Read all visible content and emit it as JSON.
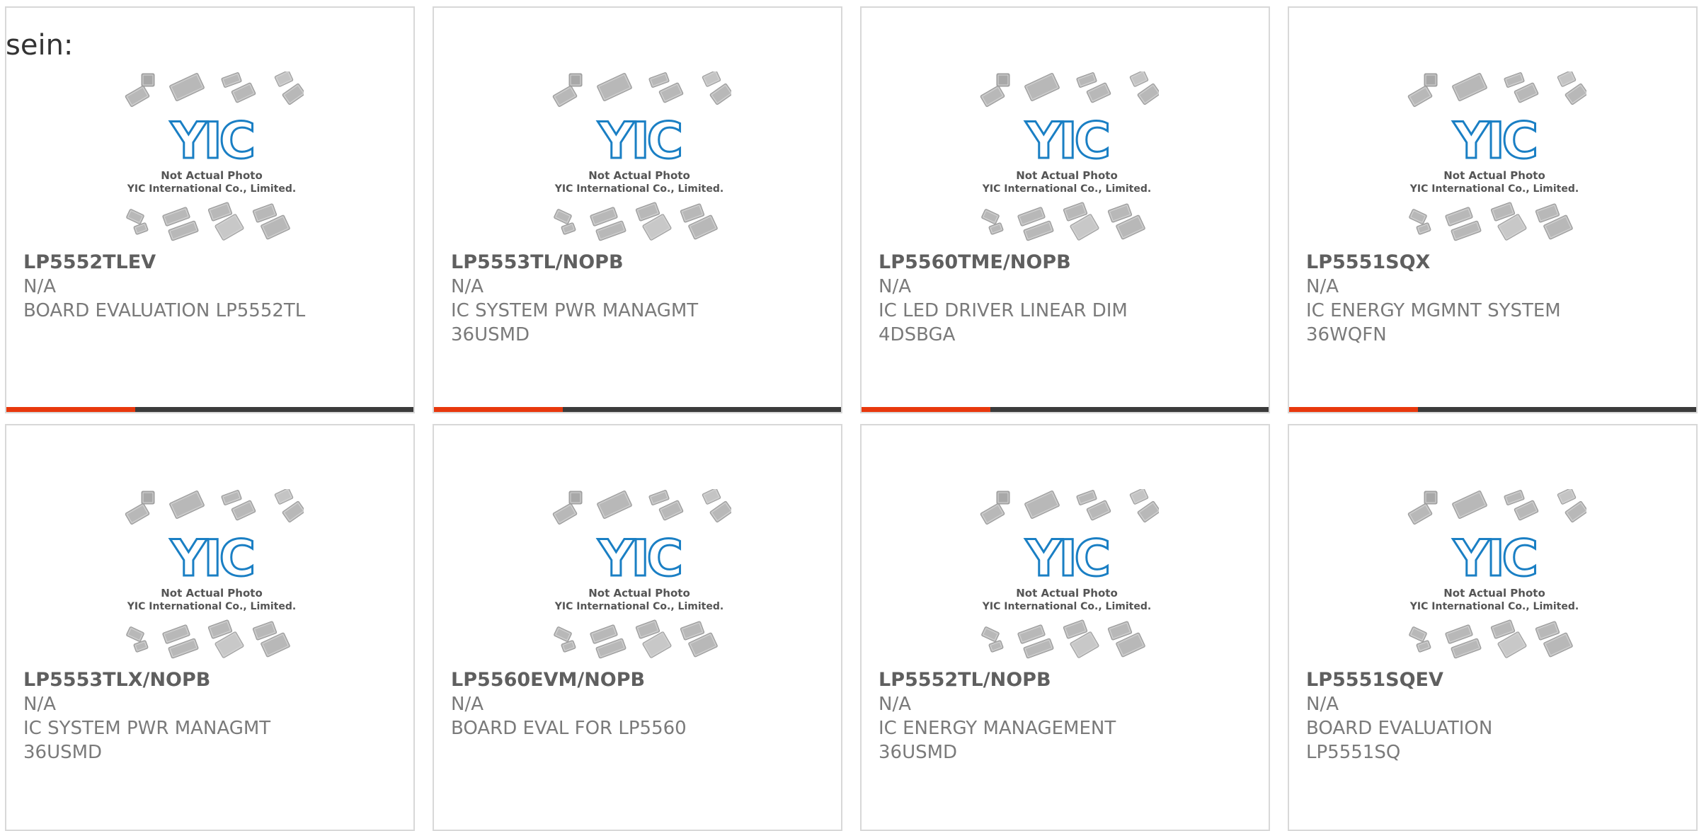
{
  "prefix_text": "sein:",
  "placeholder_photo": {
    "line1": "Not Actual Photo",
    "line2": "YIC International Co., Limited.",
    "logo_text": "YIC"
  },
  "colors": {
    "accent": "#e8380d",
    "bar": "#3b3b3b",
    "logo_blue": "#1a7fc4"
  },
  "cards": [
    {
      "part": "LP5552TLEV",
      "manufacturer": "N/A",
      "description": "BOARD EVALUATION LP5552TL",
      "accent_bar": true
    },
    {
      "part": "LP5553TL/NOPB",
      "manufacturer": "N/A",
      "description": "IC SYSTEM PWR MANAGMT 36USMD",
      "accent_bar": true
    },
    {
      "part": "LP5560TME/NOPB",
      "manufacturer": "N/A",
      "description": "IC LED DRIVER LINEAR DIM 4DSBGA",
      "accent_bar": true
    },
    {
      "part": "LP5551SQX",
      "manufacturer": "N/A",
      "description": "IC ENERGY MGMNT SYSTEM 36WQFN",
      "accent_bar": true
    },
    {
      "part": "LP5553TLX/NOPB",
      "manufacturer": "N/A",
      "description": "IC SYSTEM PWR MANAGMT 36USMD",
      "accent_bar": false
    },
    {
      "part": "LP5560EVM/NOPB",
      "manufacturer": "N/A",
      "description": "BOARD EVAL FOR LP5560",
      "accent_bar": false
    },
    {
      "part": "LP5552TL/NOPB",
      "manufacturer": "N/A",
      "description": "IC ENERGY MANAGEMENT 36USMD",
      "accent_bar": false
    },
    {
      "part": "LP5551SQEV",
      "manufacturer": "N/A",
      "description": "BOARD EVALUATION LP5551SQ",
      "accent_bar": false
    }
  ]
}
